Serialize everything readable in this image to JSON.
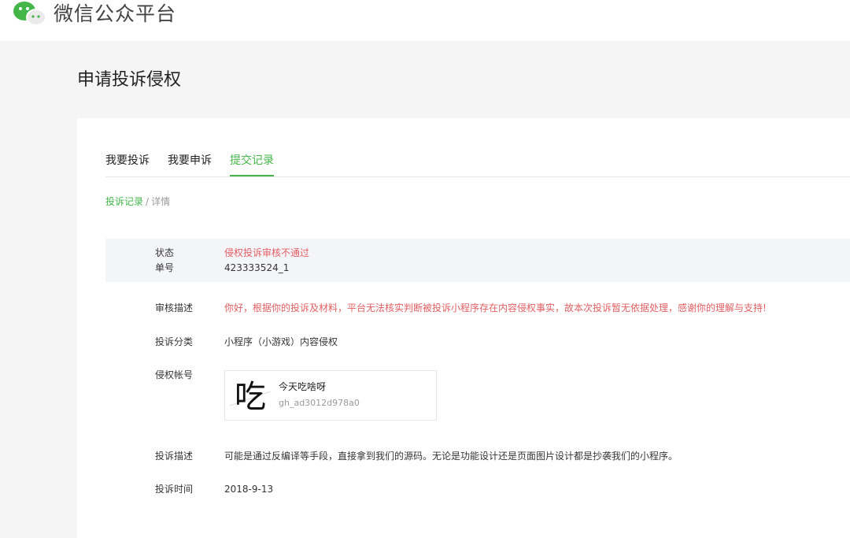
{
  "header": {
    "logo_icon": "wechat-logo-icon",
    "app_title": "微信公众平台"
  },
  "page": {
    "title": "申请投诉侵权"
  },
  "tabs": [
    {
      "label": "我要投诉",
      "active": false
    },
    {
      "label": "我要申诉",
      "active": false
    },
    {
      "label": "提交记录",
      "active": true
    }
  ],
  "breadcrumb": {
    "link": "投诉记录",
    "separator": "/",
    "current": "详情"
  },
  "detail": {
    "status_label": "状态",
    "status_value": "侵权投诉审核不通过",
    "order_label": "单号",
    "order_value": "423333524_1",
    "review_label": "审核描述",
    "review_value": "你好，根据你的投诉及材料，平台无法核实判断被投诉小程序存在内容侵权事实，故本次投诉暂无依据处理，感谢你的理解与支持!",
    "category_label": "投诉分类",
    "category_value": "小程序（小游戏）内容侵权",
    "account_label": "侵权帐号",
    "account": {
      "avatar_text": "吃",
      "name": "今天吃啥呀",
      "id": "gh_ad3012d978a0"
    },
    "complaint_label": "投诉描述",
    "complaint_value": "可能是通过反编译等手段，直接拿到我们的源码。无论是功能设计还是页面图片设计都是抄袭我们的小程序。",
    "time_label": "投诉时间",
    "time_value": "2018-9-13"
  },
  "colors": {
    "accent": "#44b549",
    "error": "#e15f63",
    "background": "#f5f5f5"
  }
}
